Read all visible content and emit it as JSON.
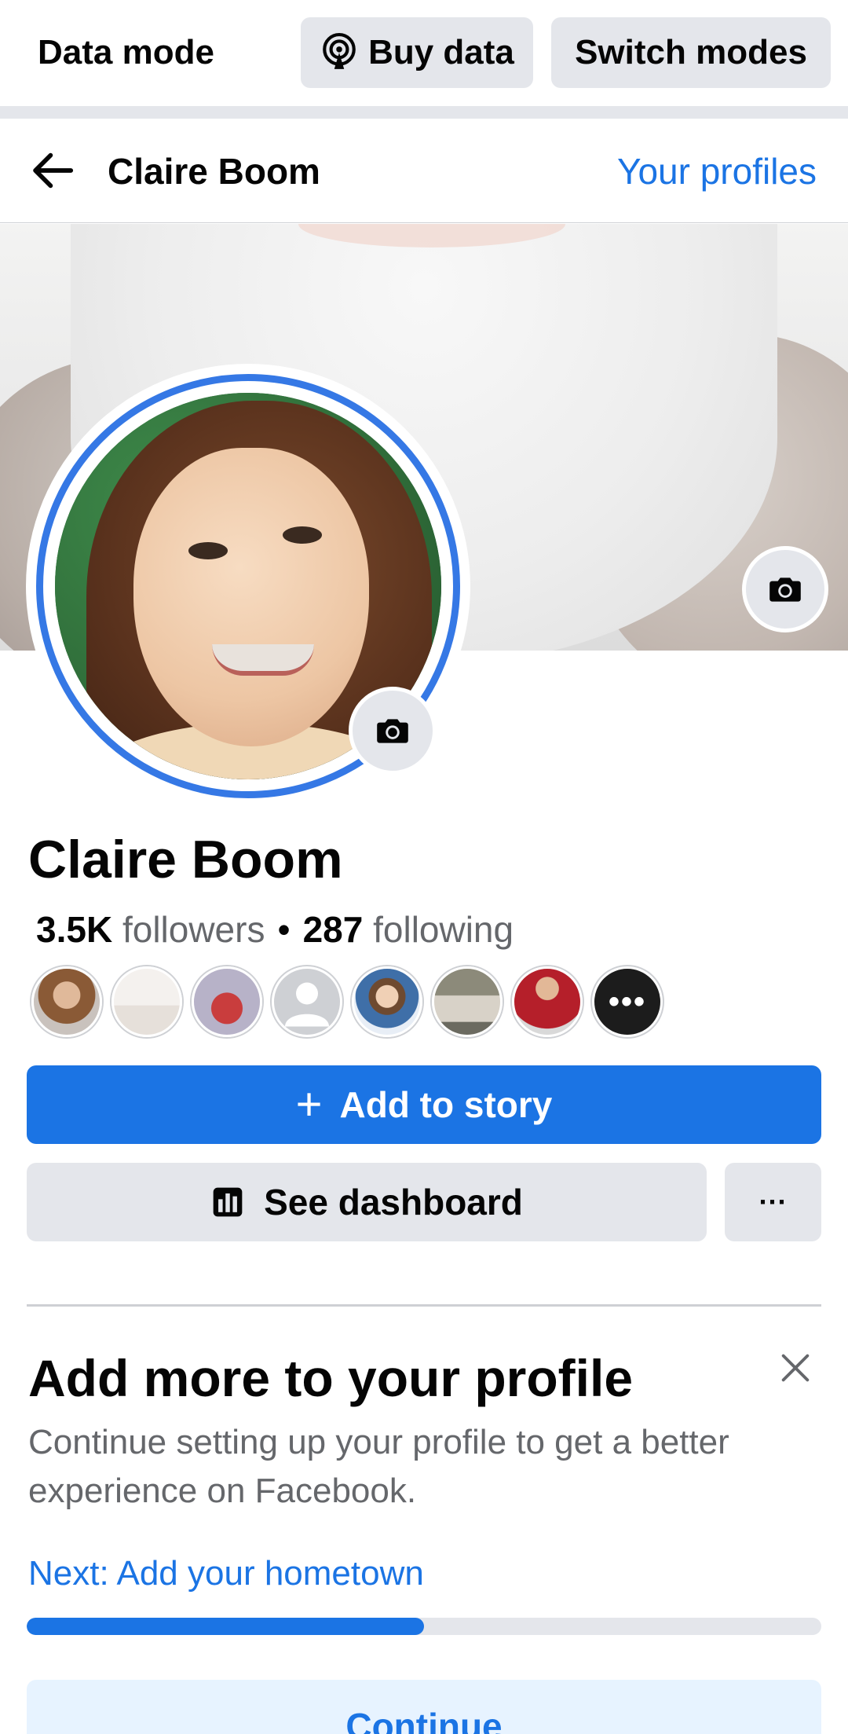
{
  "data_mode_bar": {
    "title": "Data mode",
    "buy_data_label": "Buy data",
    "switch_modes_label": "Switch modes"
  },
  "header": {
    "title": "Claire Boom",
    "your_profiles_label": "Your profiles"
  },
  "profile": {
    "name": "Claire Boom",
    "followers_count": "3.5K",
    "followers_label": "followers",
    "separator": "•",
    "following_count": "287",
    "following_label": "following",
    "more_friends_label": "•••"
  },
  "actions": {
    "add_to_story_label": "Add to story",
    "see_dashboard_label": "See dashboard",
    "more_label": "···"
  },
  "add_more_card": {
    "title": "Add more to your profile",
    "description": "Continue setting up your profile to get a better experience on Facebook.",
    "next_label": "Next: Add your hometown",
    "progress_fraction": 0.5,
    "continue_label": "Continue"
  },
  "colors": {
    "accent_blue": "#1b74e4",
    "ring_blue": "#3578e5",
    "button_gray": "#e4e6eb",
    "secondary_text": "#65676b",
    "continue_bg": "#e7f3ff"
  },
  "icons": {
    "buy_data": "broadcast-icon",
    "back": "arrow-left-icon",
    "cover_camera": "camera-icon",
    "avatar_camera": "camera-icon",
    "add_story": "plus-icon",
    "dashboard": "bar-chart-icon",
    "close": "close-icon"
  }
}
